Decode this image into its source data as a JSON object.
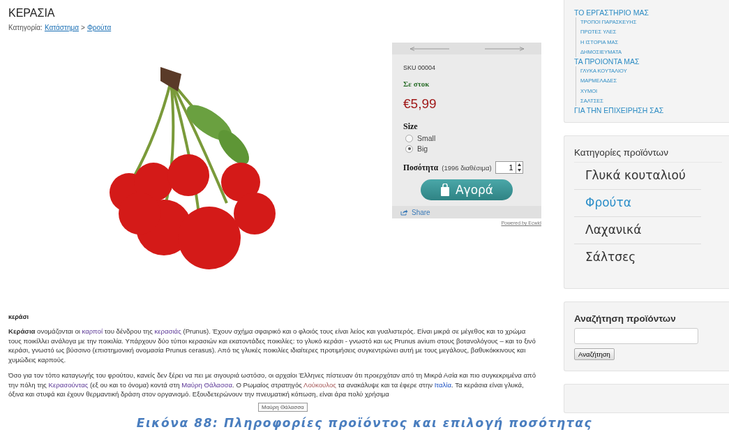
{
  "product": {
    "title": "ΚΕΡΑΣΙΑ",
    "breadcrumb": {
      "label": "Κατηγορία:",
      "separator": ">",
      "links": [
        "Κατάστημα",
        "Φρούτα"
      ]
    }
  },
  "panel": {
    "sku": "SKU 00004",
    "stock": "Σε στοκ",
    "price": "€5,99",
    "option_label": "Size",
    "options": [
      {
        "label": "Small",
        "selected": false
      },
      {
        "label": "Big",
        "selected": true
      }
    ],
    "quantity_label": "Ποσότητα",
    "available": "(1996 διαθέσιμα)",
    "quantity": "1",
    "buy": "Αγορά",
    "share": "Share",
    "powered": "Powered by Ecwid"
  },
  "description": {
    "heading": "κεράσι",
    "paragraphs": [
      [
        {
          "kind": "bold",
          "text": "Κεράσια"
        },
        {
          "kind": "plain",
          "text": " ονομάζονται οι "
        },
        {
          "kind": "visited",
          "text": "καρποί"
        },
        {
          "kind": "plain",
          "text": " του δένδρου της "
        },
        {
          "kind": "visited",
          "text": "κερασιάς"
        },
        {
          "kind": "plain",
          "text": " (Prunus). Έχουν σχήμα σφαιρικό και ο φλοιός τους είναι λείος και γυαλιστερός. Είναι μικρά σε μέγεθος και το χρώμα τους ποικίλλει ανάλογα με την ποικιλία. Υπάρχουν δύο τύποι κερασιών και εκατοντάδες ποικιλίες: το γλυκό κεράσι - γνωστό και ως Prunus avium στους βοτανολόγους – και το ξινό κεράσι, γνωστό ως βύσσινο (επιστημονική ονομασία Prunus cerasus). Από τις γλυκές ποικιλίες ιδιαίτερες προτιμήσεις συγκεντρώνει αυτή με τους μεγάλους, βαθυκόκκινους και χυμώδεις καρπούς."
        }
      ],
      [
        {
          "kind": "plain",
          "text": "Όσο για τον τόπο καταγωγής του φρούτου, κανείς δεν ξέρει να πει με σιγουριά ωστόσο, οι αρχαίοι Έλληνες πίστευαν ότι προερχόταν από τη Μικρά Ασία και πιο συγκεκριμένα από την πόλη της "
        },
        {
          "kind": "visited",
          "text": "Κερασούντας"
        },
        {
          "kind": "plain",
          "text": " (εξ ου και το όνομα) κοντά στη "
        },
        {
          "kind": "visited",
          "text": "Μαύρη Θάλασσα"
        },
        {
          "kind": "plain",
          "text": ". Ο Ρωμαίος στρατηγός "
        },
        {
          "kind": "new",
          "text": "Λούκουλος"
        },
        {
          "kind": "plain",
          "text": " τα ανακάλυψε και τα έφερε στην "
        },
        {
          "kind": "link",
          "text": "Ιταλία"
        },
        {
          "kind": "plain",
          "text": ". Τα κεράσια είναι γλυκά, όξινα και στυφά και έχουν θερμαντική δράση στον οργανισμό. Εξουδετερώνουν την πνευματική κόπωση, είναι άρα πολύ χρήσιμα"
        }
      ]
    ],
    "tooltip": "Μαύρη Θάλασσα"
  },
  "menu": {
    "items": [
      {
        "label": "ΤΟ ΕΡΓΑΣΤΗΡΙΟ ΜΑΣ",
        "children": [
          {
            "label": "ΤΡΟΠΟΙ ΠΑΡΑΣΚΕΥΗΣ"
          },
          {
            "label": "ΠΡΩΤΕΣ ΥΛΕΣ"
          },
          {
            "label": "Η ΙΣΤΟΡΙΑ ΜΑΣ"
          },
          {
            "label": "ΔΗΜΟΣΙΕΥΜΑΤΑ"
          }
        ]
      },
      {
        "label": "ΤΑ ΠΡΟΙΟΝΤΑ ΜΑΣ",
        "children": [
          {
            "label": "ΓΛΥΚΑ ΚΟΥΤΑΛΙΟΥ"
          },
          {
            "label": "ΜΑΡΜΕΛΑΔΕΣ"
          },
          {
            "label": "ΧΥΜΟΙ"
          },
          {
            "label": "ΣΑΛΤΣΕΣ"
          }
        ]
      },
      {
        "label": "ΓΙΑ ΤΗΝ ΕΠΙΧΕΙΡΗΣΗ ΣΑΣ"
      }
    ]
  },
  "categories": {
    "title": "Κατηγορίες προϊόντων",
    "items": [
      {
        "label": "Γλυκά κουταλιού",
        "selected": false
      },
      {
        "label": "Φρούτα",
        "selected": true
      },
      {
        "label": "Λαχανικά",
        "selected": false
      },
      {
        "label": "Σάλτσες",
        "selected": false
      }
    ]
  },
  "search": {
    "title": "Αναζήτηση προϊόντων",
    "button": "Αναζήτηση"
  },
  "caption": "Εικόνα 88: Πληροφορίες προϊόντος και επιλογή ποσότητας"
}
